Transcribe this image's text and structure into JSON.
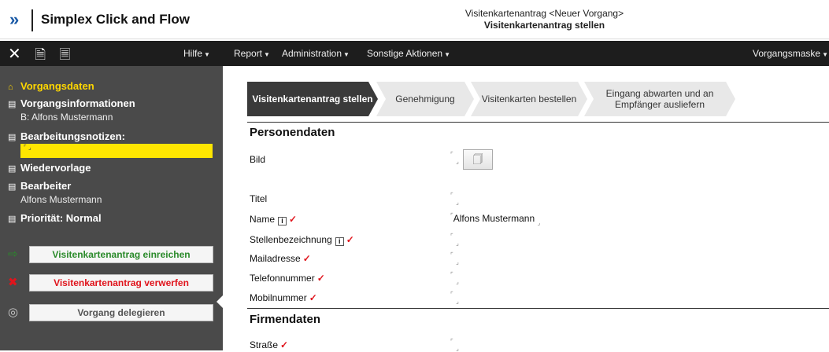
{
  "header": {
    "logo": "»",
    "app_title": "Simplex Click and Flow",
    "doc_title": "Visitenkartenantrag <Neuer Vorgang>",
    "doc_subtitle": "Visitenkartenantrag stellen"
  },
  "menubar": {
    "tools": "✕ 🗎 🗏",
    "help": "Hilfe",
    "items": [
      "Report",
      "Administration",
      "Sonstige Aktionen"
    ],
    "right": "Vorgangsmaske"
  },
  "sidebar": {
    "vorgangsdaten": "Vorgangsdaten",
    "vorgangsinfo": "Vorgangsinformationen",
    "vorgangsinfo_sub": "B: Alfons Mustermann",
    "notizen": "Bearbeitungsnotizen:",
    "wiedervorlage": "Wiedervorlage",
    "bearbeiter": "Bearbeiter",
    "bearbeiter_sub": "Alfons Mustermann",
    "prioritaet": "Priorität: Normal",
    "actions": {
      "submit": "Visitenkartenantrag einreichen",
      "discard": "Visitenkartenantrag verwerfen",
      "delegate": "Vorgang delegieren"
    }
  },
  "steps": [
    {
      "label": "Visitenkartenantrag stellen"
    },
    {
      "label": "Genehmigung"
    },
    {
      "label": "Visitenkarten bestellen"
    },
    {
      "label": "Eingang abwarten und an Empfänger ausliefern"
    }
  ],
  "form": {
    "section1": "Personendaten",
    "section2": "Firmendaten",
    "fields": {
      "bild": "Bild",
      "titel": "Titel",
      "name": "Name",
      "name_value": "Alfons Mustermann",
      "stelle": "Stellenbezeichnung",
      "mail": "Mailadresse",
      "telefon": "Telefonnummer",
      "mobil": "Mobilnummer",
      "strasse": "Straße"
    }
  },
  "colors": {
    "accent": "#ffd700",
    "sidebar": "#4a4a4a",
    "menubar": "#1d1d1d",
    "required": "#e0141c"
  }
}
